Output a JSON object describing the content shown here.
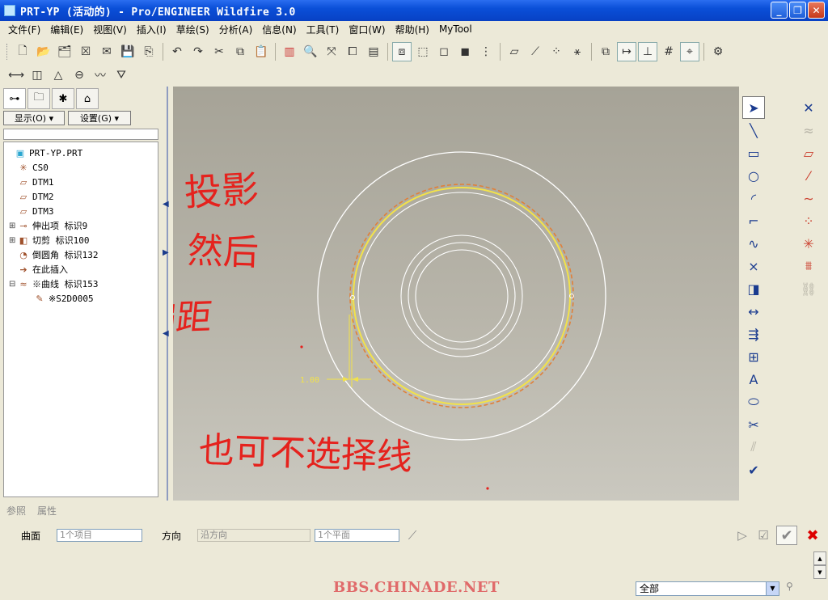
{
  "window": {
    "title": "PRT-YP (活动的) - Pro/ENGINEER Wildfire 3.0",
    "minimize_glyph": "_",
    "restore_glyph": "❐",
    "close_glyph": "✕"
  },
  "menu": [
    "文件(F)",
    "编辑(E)",
    "视图(V)",
    "插入(I)",
    "草绘(S)",
    "分析(A)",
    "信息(N)",
    "工具(T)",
    "窗口(W)",
    "帮助(H)",
    "MyTool"
  ],
  "navigator": {
    "show_button": "显示(O) ▾",
    "settings_button": "设置(G) ▾",
    "tree": [
      {
        "label": "PRT-YP.PRT",
        "icon": "part-icon",
        "glyph": "▣",
        "expander": ""
      },
      {
        "label": "CS0",
        "icon": "csys-icon",
        "glyph": "✳",
        "expander": ""
      },
      {
        "label": "DTM1",
        "icon": "datum-plane-icon",
        "glyph": "▱",
        "expander": ""
      },
      {
        "label": "DTM2",
        "icon": "datum-plane-icon",
        "glyph": "▱",
        "expander": ""
      },
      {
        "label": "DTM3",
        "icon": "datum-plane-icon",
        "glyph": "▱",
        "expander": ""
      },
      {
        "label": "伸出项 标识9",
        "icon": "protrusion-icon",
        "glyph": "⊸",
        "expander": "⊞"
      },
      {
        "label": "切剪 标识100",
        "icon": "cut-icon",
        "glyph": "◧",
        "expander": "⊞"
      },
      {
        "label": "倒圆角 标识132",
        "icon": "round-icon",
        "glyph": "◔",
        "expander": ""
      },
      {
        "label": "在此插入",
        "icon": "insert-here-arrow-icon",
        "glyph": "➔",
        "expander": ""
      },
      {
        "label": "※曲线 标识153",
        "icon": "curve-icon",
        "glyph": "≈",
        "expander": "⊟"
      },
      {
        "label": "※S2D0005",
        "icon": "sketch-icon",
        "glyph": "✎",
        "expander": "",
        "indent": true
      }
    ]
  },
  "graphics": {
    "dimension_value": "1.00",
    "annotations": [
      "投影",
      "然后",
      "偏距",
      "也可不选择线"
    ]
  },
  "dashboard": {
    "tabs": [
      "参照",
      "属性"
    ],
    "surface_label": "曲面",
    "surface_value": "1个项目",
    "direction_label": "方向",
    "direction_value": "沿方向",
    "plane_value": "1个平面"
  },
  "status": {
    "watermark": "BBS.CHINADE.NET",
    "filter_value": "全部"
  }
}
